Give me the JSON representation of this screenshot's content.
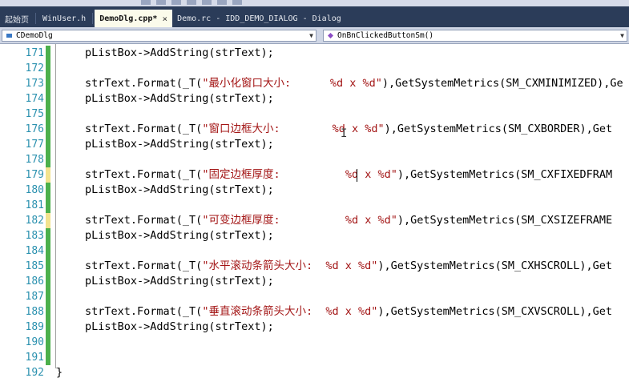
{
  "tabs": [
    {
      "label": "起始页",
      "active": false,
      "closable": false
    },
    {
      "label": "WinUser.h",
      "active": false,
      "closable": false
    },
    {
      "label": "DemoDlg.cpp*",
      "active": true,
      "closable": true
    },
    {
      "label": "Demo.rc - IDD_DEMO_DIALOG - Dialog",
      "active": false,
      "closable": false
    }
  ],
  "tab_close_glyph": "×",
  "nav": {
    "class_combo": "CDemoDlg",
    "method_combo": "OnBnClickedButtonSm()"
  },
  "colors": {
    "tab_bar": "#2b3c59",
    "active_tab": "#fbfbeb",
    "line_number": "#2b91af",
    "string": "#a31515",
    "saved_change": "#4cb04c",
    "unsaved_change": "#f2e38e"
  },
  "code_lines": [
    {
      "no": "171",
      "pre": "pListBox->AddString(strText);",
      "str": "",
      "post": "",
      "mod": "saved"
    },
    {
      "no": "172",
      "pre": "",
      "str": "",
      "post": "",
      "mod": "saved"
    },
    {
      "no": "173",
      "pre": "strText.Format(_T(",
      "str": "\"最小化窗口大小:      %d x %d\"",
      "post": "),GetSystemMetrics(SM_CXMINIMIZED),Ge",
      "mod": "saved"
    },
    {
      "no": "174",
      "pre": "pListBox->AddString(strText);",
      "str": "",
      "post": "",
      "mod": "saved"
    },
    {
      "no": "175",
      "pre": "",
      "str": "",
      "post": "",
      "mod": "saved"
    },
    {
      "no": "176",
      "pre": "strText.Format(_T(",
      "str": "\"窗口边框大小:        %d x %d\"",
      "post": "),GetSystemMetrics(SM_CXBORDER),Get",
      "mod": "saved"
    },
    {
      "no": "177",
      "pre": "pListBox->AddString(strText);",
      "str": "",
      "post": "",
      "mod": "saved"
    },
    {
      "no": "178",
      "pre": "",
      "str": "",
      "post": "",
      "mod": "saved"
    },
    {
      "no": "179",
      "pre": "strText.Format(_T(",
      "str": "\"固定边框厚度:          %d x %d\"",
      "post": "),GetSystemMetrics(SM_CXFIXEDFRAM",
      "mod": "unsaved"
    },
    {
      "no": "180",
      "pre": "pListBox->AddString(strText);",
      "str": "",
      "post": "",
      "mod": "saved"
    },
    {
      "no": "181",
      "pre": "",
      "str": "",
      "post": "",
      "mod": "saved"
    },
    {
      "no": "182",
      "pre": "strText.Format(_T(",
      "str": "\"可变边框厚度:          %d x %d\"",
      "post": "),GetSystemMetrics(SM_CXSIZEFRAME",
      "mod": "unsaved"
    },
    {
      "no": "183",
      "pre": "pListBox->AddString(strText);",
      "str": "",
      "post": "",
      "mod": "saved"
    },
    {
      "no": "184",
      "pre": "",
      "str": "",
      "post": "",
      "mod": "saved"
    },
    {
      "no": "185",
      "pre": "strText.Format(_T(",
      "str": "\"水平滚动条箭头大小:  %d x %d\"",
      "post": "),GetSystemMetrics(SM_CXHSCROLL),Get",
      "mod": "saved"
    },
    {
      "no": "186",
      "pre": "pListBox->AddString(strText);",
      "str": "",
      "post": "",
      "mod": "saved"
    },
    {
      "no": "187",
      "pre": "",
      "str": "",
      "post": "",
      "mod": "saved"
    },
    {
      "no": "188",
      "pre": "strText.Format(_T(",
      "str": "\"垂直滚动条箭头大小:  %d x %d\"",
      "post": "),GetSystemMetrics(SM_CXVSCROLL),Get",
      "mod": "saved"
    },
    {
      "no": "189",
      "pre": "pListBox->AddString(strText);",
      "str": "",
      "post": "",
      "mod": "saved"
    },
    {
      "no": "190",
      "pre": "",
      "str": "",
      "post": "",
      "mod": "saved"
    },
    {
      "no": "191",
      "pre": "",
      "str": "",
      "post": "",
      "mod": "saved"
    },
    {
      "no": "192",
      "pre": "}",
      "str": "",
      "post": "",
      "mod": "none"
    }
  ]
}
